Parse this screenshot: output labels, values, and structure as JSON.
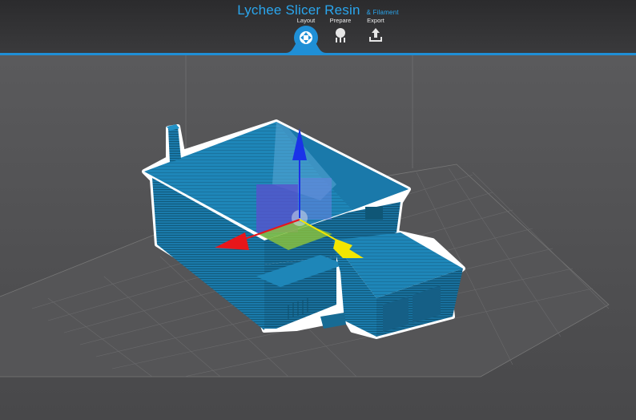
{
  "app": {
    "title": "Lychee Slicer Resin",
    "subtitle": "& Filament"
  },
  "tabs": [
    {
      "label": "Layout",
      "icon": "move-arrows-icon",
      "active": true
    },
    {
      "label": "Prepare",
      "icon": "supports-icon",
      "active": false
    },
    {
      "label": "Export",
      "icon": "export-icon",
      "active": false
    }
  ],
  "viewport": {
    "model": "house-model",
    "gizmo": "translate-gizmo",
    "colors": {
      "model": "#1d7fb0",
      "gizmo_x": "#e8161a",
      "gizmo_y": "#f3e600",
      "gizmo_z": "#1a33e8",
      "accent": "#1f8fd6"
    }
  }
}
